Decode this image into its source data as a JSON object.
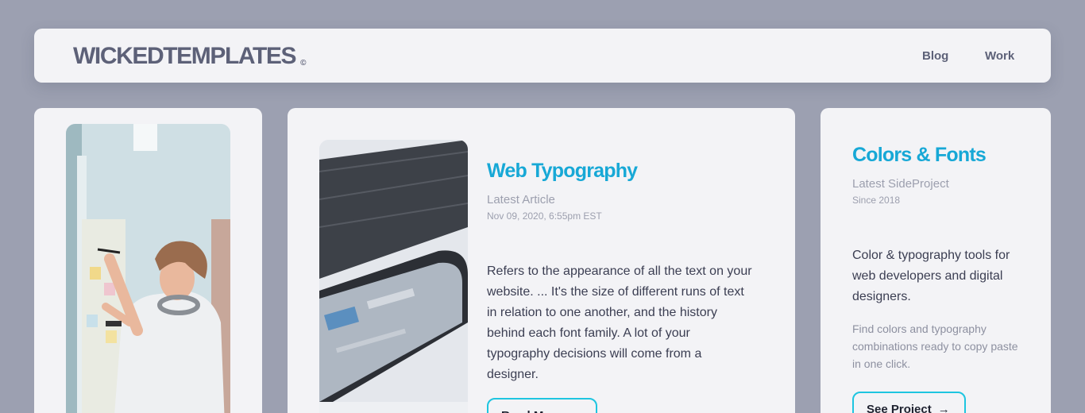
{
  "header": {
    "logo": "WICKEDTEMPLATES",
    "logo_mark": "©",
    "nav": [
      "Blog",
      "Work"
    ]
  },
  "article": {
    "title": "Web Typography",
    "label": "Latest Article",
    "date": "Nov 09, 2020, 6:55pm EST",
    "body_lines": [
      "Refers to the appearance of all the text on your",
      "website. ... It's the size of different runs of text",
      "in relation to one another, and the history",
      "behind each font family. A lot of your",
      "typography decisions will come from a",
      "designer."
    ],
    "button": "Read More"
  },
  "project": {
    "title": "Colors & Fonts",
    "label": "Latest SideProject",
    "since": "Since 2018",
    "description_lines": [
      "Color & typography tools for",
      "web developers and digital",
      "designers."
    ],
    "detail_lines": [
      "Find colors and typography",
      "combinations ready to copy paste",
      "in one click."
    ],
    "button": "See Project",
    "button_icon": "arrow-right-icon"
  }
}
